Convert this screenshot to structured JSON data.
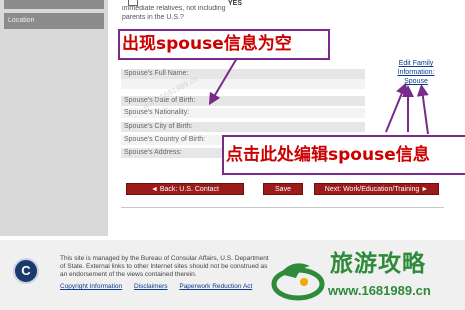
{
  "sidebar": {
    "items": [
      "",
      "Location"
    ]
  },
  "top": {
    "question_text": "immediate relatives, not including parents in the U.S.?",
    "yes_label": "YES"
  },
  "form": {
    "fields": [
      "Spouse's Full Name:",
      "Spouse's Date of Birth:",
      "Spouse's Nationality:",
      "Spouse's City of Birth:",
      "Spouse's Country of Birth:",
      "Spouse's Address:"
    ],
    "edit_link": "Edit Family Information: Spouse"
  },
  "annotations": {
    "top": "出现spouse信息为空",
    "bottom": "点击此处编辑spouse信息",
    "color": "#cc0000",
    "border_color": "#7a2a8a"
  },
  "buttons": {
    "back": "◄ Back: U.S. Contact",
    "save": "Save",
    "next": "Next: Work/Education/Training ►",
    "color": "#9b1b1b"
  },
  "footer": {
    "seal_letter": "C",
    "text": "This site is managed by the Bureau of Consular Affairs, U.S. Department of State. External links to other Internet sites should not be construed as an endorsement of the views contained therein.",
    "links": [
      "Copyright Information",
      "Disclaimers",
      "Paperwork Reduction Act"
    ]
  },
  "watermark": {
    "brand": "旅游攻略",
    "url": "www.1681989.cn",
    "color": "#2e8b3a"
  }
}
